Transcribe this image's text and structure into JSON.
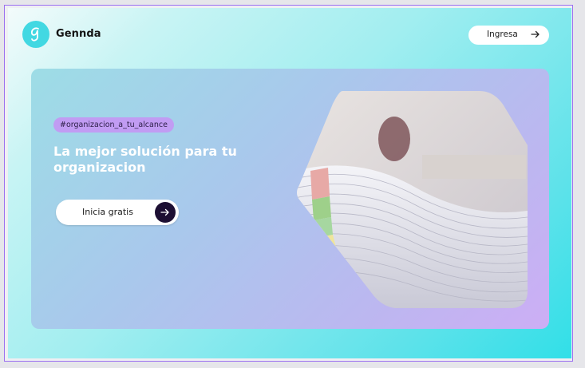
{
  "header": {
    "brand": "Gennda",
    "login_label": "Ingresa"
  },
  "hero": {
    "tag": "#organizacion_a_tu_alcance",
    "headline": "La mejor solución para tu organizacion",
    "cta_label": "Inicia gratis",
    "image_description_icon": "paper-stack-photo"
  },
  "colors": {
    "accent_dark": "#1d0f33",
    "tag_bg": "#c19cf3",
    "logo_bg": "#42d8e2"
  }
}
